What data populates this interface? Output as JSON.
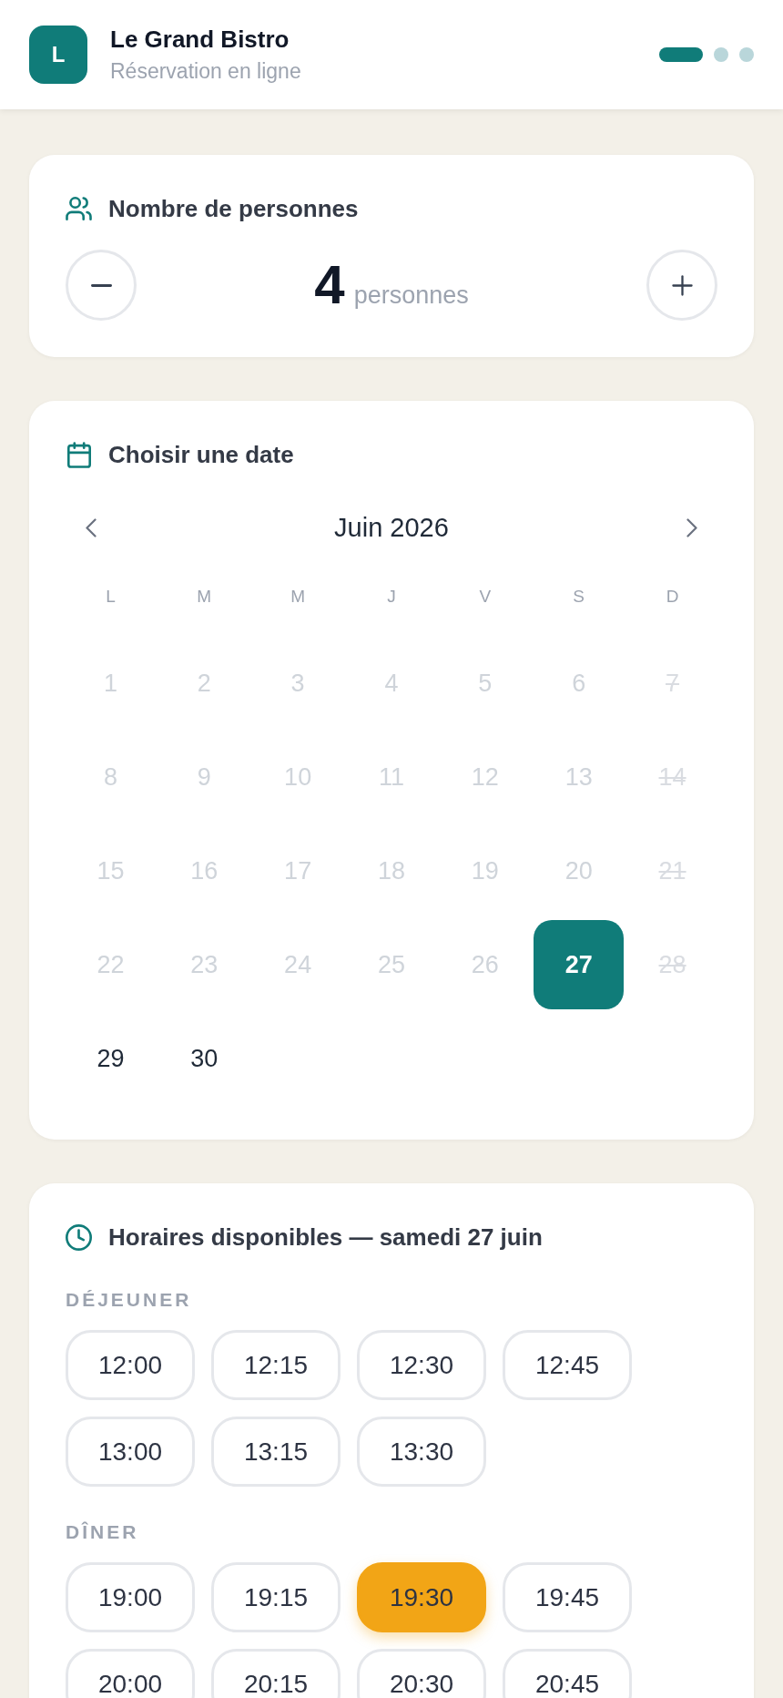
{
  "header": {
    "logo_letter": "L",
    "title": "Le Grand Bistro",
    "subtitle": "Réservation en ligne",
    "steps": [
      {
        "selected": true
      },
      {
        "selected": false
      },
      {
        "selected": false
      }
    ]
  },
  "party": {
    "title": "Nombre de personnes",
    "count": "4",
    "unit": "personnes"
  },
  "date": {
    "title": "Choisir une date",
    "month": "Juin 2026",
    "weekdays": [
      "L",
      "M",
      "M",
      "J",
      "V",
      "S",
      "D"
    ],
    "days": [
      {
        "label": "1",
        "selected": false,
        "disabled": true,
        "closed": false
      },
      {
        "label": "2",
        "selected": false,
        "disabled": true,
        "closed": false
      },
      {
        "label": "3",
        "selected": false,
        "disabled": true,
        "closed": false
      },
      {
        "label": "4",
        "selected": false,
        "disabled": true,
        "closed": false
      },
      {
        "label": "5",
        "selected": false,
        "disabled": true,
        "closed": false
      },
      {
        "label": "6",
        "selected": false,
        "disabled": true,
        "closed": false
      },
      {
        "label": "7",
        "selected": false,
        "disabled": false,
        "closed": true
      },
      {
        "label": "8",
        "selected": false,
        "disabled": true,
        "closed": false
      },
      {
        "label": "9",
        "selected": false,
        "disabled": true,
        "closed": false
      },
      {
        "label": "10",
        "selected": false,
        "disabled": true,
        "closed": false
      },
      {
        "label": "11",
        "selected": false,
        "disabled": true,
        "closed": false
      },
      {
        "label": "12",
        "selected": false,
        "disabled": true,
        "closed": false
      },
      {
        "label": "13",
        "selected": false,
        "disabled": true,
        "closed": false
      },
      {
        "label": "14",
        "selected": false,
        "disabled": false,
        "closed": true
      },
      {
        "label": "15",
        "selected": false,
        "disabled": true,
        "closed": false
      },
      {
        "label": "16",
        "selected": false,
        "disabled": true,
        "closed": false
      },
      {
        "label": "17",
        "selected": false,
        "disabled": true,
        "closed": false
      },
      {
        "label": "18",
        "selected": false,
        "disabled": true,
        "closed": false
      },
      {
        "label": "19",
        "selected": false,
        "disabled": true,
        "closed": false
      },
      {
        "label": "20",
        "selected": false,
        "disabled": true,
        "closed": false
      },
      {
        "label": "21",
        "selected": false,
        "disabled": false,
        "closed": true
      },
      {
        "label": "22",
        "selected": false,
        "disabled": true,
        "closed": false
      },
      {
        "label": "23",
        "selected": false,
        "disabled": true,
        "closed": false
      },
      {
        "label": "24",
        "selected": false,
        "disabled": true,
        "closed": false
      },
      {
        "label": "25",
        "selected": false,
        "disabled": true,
        "closed": false
      },
      {
        "label": "26",
        "selected": false,
        "disabled": true,
        "closed": false
      },
      {
        "label": "27",
        "selected": true,
        "disabled": false,
        "closed": false
      },
      {
        "label": "28",
        "selected": false,
        "disabled": false,
        "closed": true
      },
      {
        "label": "29",
        "selected": false,
        "disabled": false,
        "closed": false
      },
      {
        "label": "30",
        "selected": false,
        "disabled": false,
        "closed": false
      }
    ]
  },
  "times": {
    "title": "Horaires disponibles — samedi 27 juin",
    "services": [
      {
        "label": "DÉJEUNER",
        "slots": [
          {
            "label": "12:00",
            "selected": false
          },
          {
            "label": "12:15",
            "selected": false
          },
          {
            "label": "12:30",
            "selected": false
          },
          {
            "label": "12:45",
            "selected": false
          },
          {
            "label": "13:00",
            "selected": false
          },
          {
            "label": "13:15",
            "selected": false
          },
          {
            "label": "13:30",
            "selected": false
          }
        ]
      },
      {
        "label": "DÎNER",
        "slots": [
          {
            "label": "19:00",
            "selected": false
          },
          {
            "label": "19:15",
            "selected": false
          },
          {
            "label": "19:30",
            "selected": true
          },
          {
            "label": "19:45",
            "selected": false
          },
          {
            "label": "20:00",
            "selected": false
          },
          {
            "label": "20:15",
            "selected": false
          },
          {
            "label": "20:30",
            "selected": false
          },
          {
            "label": "20:45",
            "selected": false
          }
        ]
      }
    ]
  }
}
